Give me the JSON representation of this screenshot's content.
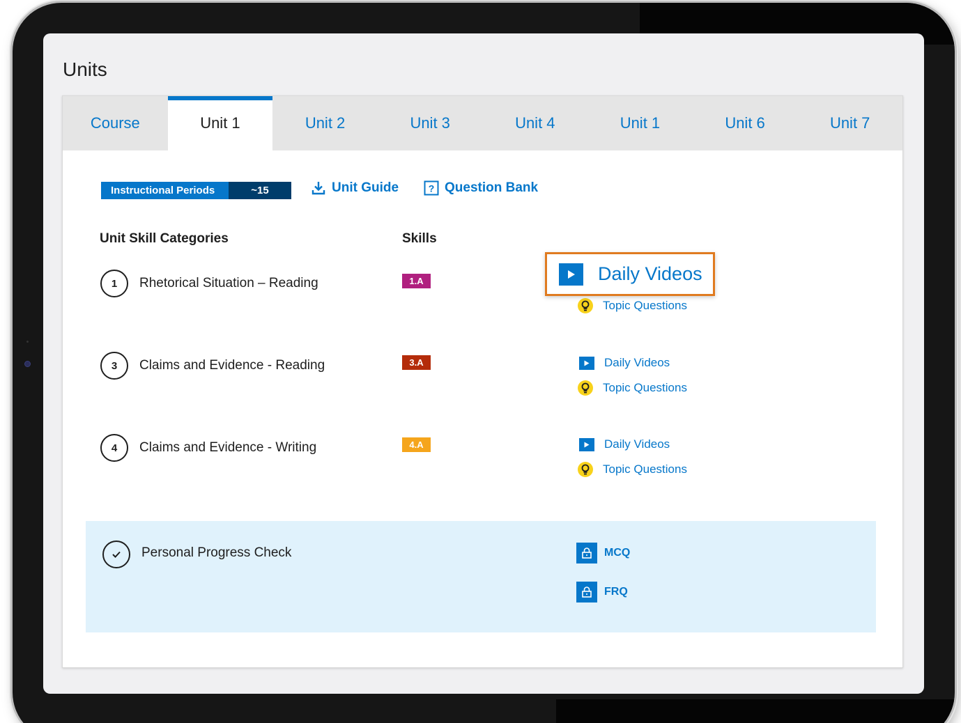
{
  "page": {
    "title": "Units"
  },
  "tabs": [
    {
      "label": "Course",
      "active": false
    },
    {
      "label": "Unit 1",
      "active": true
    },
    {
      "label": "Unit 2",
      "active": false
    },
    {
      "label": "Unit 3",
      "active": false
    },
    {
      "label": "Unit 4",
      "active": false
    },
    {
      "label": "Unit 1",
      "active": false
    },
    {
      "label": "Unit 6",
      "active": false
    },
    {
      "label": "Unit 7",
      "active": false
    }
  ],
  "info": {
    "periods_label": "Instructional Periods",
    "periods_value": "~15",
    "unit_guide": "Unit Guide",
    "question_bank": "Question Bank"
  },
  "columns": {
    "categories": "Unit Skill Categories",
    "skills": "Skills"
  },
  "skill_rows": [
    {
      "number": "1",
      "name": "Rhetorical Situation – Reading",
      "tag": "1.A",
      "tag_color": "#b0207f",
      "videos": "Daily Videos",
      "questions": "Topic Questions"
    },
    {
      "number": "3",
      "name": "Claims and Evidence - Reading",
      "tag": "3.A",
      "tag_color": "#b42c0a",
      "videos": "Daily Videos",
      "questions": "Topic Questions"
    },
    {
      "number": "4",
      "name": "Claims and Evidence - Writing",
      "tag": "4.A",
      "tag_color": "#f5a51c",
      "videos": "Daily Videos",
      "questions": "Topic Questions"
    }
  ],
  "highlight": {
    "label": "Daily Videos",
    "border_color": "#e07b20"
  },
  "progress_check": {
    "label": "Personal Progress Check",
    "mcq": "MCQ",
    "frq": "FRQ"
  },
  "colors": {
    "accent": "#0677ca",
    "dark_blue": "#003d6b",
    "ppc_bg": "#e0f2fc",
    "bulb": "#f8d21b"
  },
  "icons": [
    "download-icon",
    "question-icon",
    "play-icon",
    "lightbulb-icon",
    "lock-icon",
    "check-icon"
  ]
}
